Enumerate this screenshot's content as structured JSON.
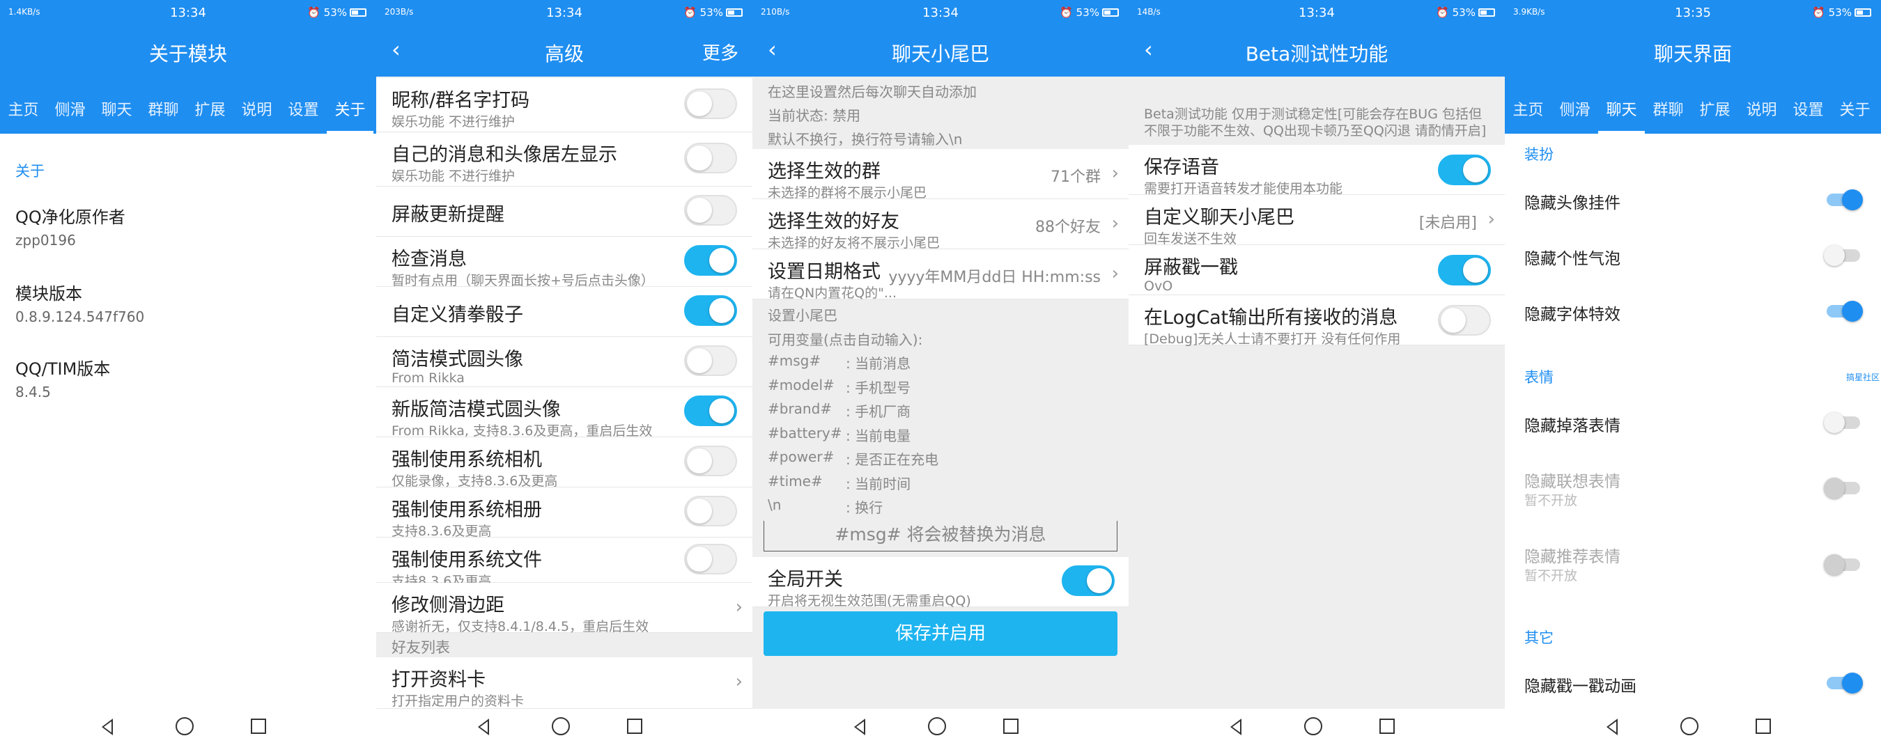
{
  "status": {
    "p1": {
      "net": "1.4KB/s",
      "time": "13:34",
      "battery": "53%"
    },
    "p2": {
      "net": "203B/s",
      "time": "13:34",
      "battery": "53%"
    },
    "p3": {
      "net": "210B/s",
      "time": "13:34",
      "battery": "53%"
    },
    "p4": {
      "net": "14B/s",
      "time": "13:34",
      "battery": "53%"
    },
    "p5": {
      "net": "3.9KB/s",
      "time": "13:35",
      "battery": "53%"
    }
  },
  "tabs": [
    "主页",
    "侧滑",
    "聊天",
    "群聊",
    "扩展",
    "说明",
    "设置",
    "关于"
  ],
  "panel1": {
    "title": "关于模块",
    "section": "关于",
    "items": [
      {
        "title": "QQ净化原作者",
        "sub": "zpp0196"
      },
      {
        "title": "模块版本",
        "sub": "0.8.9.124.547f760"
      },
      {
        "title": "QQ/TIM版本",
        "sub": "8.4.5"
      }
    ]
  },
  "panel2": {
    "title": "高级",
    "more": "更多",
    "rows": [
      {
        "title": "昵称/群名字打码",
        "sub": "娱乐功能 不进行维护",
        "on": false
      },
      {
        "title": "自己的消息和头像居左显示",
        "sub": "娱乐功能 不进行维护",
        "on": false
      },
      {
        "title": "屏蔽更新提醒",
        "sub": "",
        "on": false
      },
      {
        "title": "检查消息",
        "sub": "暂时有点用（聊天界面长按+号后点击头像）",
        "on": true
      },
      {
        "title": "自定义猜拳骰子",
        "sub": "",
        "on": true
      },
      {
        "title": "简洁模式圆头像",
        "sub": "From Rikka",
        "on": false
      },
      {
        "title": "新版简洁模式圆头像",
        "sub": "From Rikka, 支持8.3.6及更高，重启后生效",
        "on": true
      },
      {
        "title": "强制使用系统相机",
        "sub": "仅能录像，支持8.3.6及更高",
        "on": false
      },
      {
        "title": "强制使用系统相册",
        "sub": "支持8.3.6及更高",
        "on": false
      },
      {
        "title": "强制使用系统文件",
        "sub": "支持8.3.6及更高",
        "on": false
      }
    ],
    "side_row": {
      "title": "修改侧滑边距",
      "sub": "感谢祈无，仅支持8.4.1/8.4.5，重启后生效"
    },
    "section": "好友列表",
    "card_row": {
      "title": "打开资料卡",
      "sub": "打开指定用户的资料卡"
    }
  },
  "panel3": {
    "title": "聊天小尾巴",
    "info1": "在这里设置然后每次聊天自动添加",
    "info2": "当前状态: 禁用",
    "info3": "默认不换行，换行符号请输入\\n",
    "rows": [
      {
        "title": "选择生效的群",
        "sub": "未选择的群将不展示小尾巴",
        "value": "71个群"
      },
      {
        "title": "选择生效的好友",
        "sub": "未选择的好友将不展示小尾巴",
        "value": "88个好友"
      },
      {
        "title": "设置日期格式",
        "sub": "请在QN内置花Q的\"...",
        "value": "yyyy年MM月dd日 HH:mm:ss"
      }
    ],
    "vars_title": "设置小尾巴",
    "vars_intro": "可用变量(点击自动输入):",
    "vars": [
      {
        "key": "#msg#",
        "desc": ": 当前消息"
      },
      {
        "key": "#model#",
        "desc": ": 手机型号"
      },
      {
        "key": "#brand#",
        "desc": ": 手机厂商"
      },
      {
        "key": "#battery#",
        "desc": ": 当前电量"
      },
      {
        "key": "#power#",
        "desc": ": 是否正在充电"
      },
      {
        "key": "#time#",
        "desc": ": 当前时间"
      },
      {
        "key": "\\n",
        "desc": ": 换行"
      }
    ],
    "input_placeholder": "#msg# 将会被替换为消息",
    "global": {
      "title": "全局开关",
      "sub": "开启将无视生效范围(无需重启QQ)",
      "on": true
    },
    "save_label": "保存并启用"
  },
  "panel4": {
    "title": "Beta测试性功能",
    "desc": "Beta测试功能 仅用于测试稳定性[可能会存在BUG 包括但不限于功能不生效、QQ出现卡顿乃至QQ闪退 请酌情开启]",
    "rows": [
      {
        "title": "保存语音",
        "sub": "需要打开语音转发才能使用本功能",
        "on": true
      },
      {
        "title": "自定义聊天小尾巴",
        "sub": "回车发送不生效",
        "value": "[未启用]"
      },
      {
        "title": "屏蔽戳一戳",
        "sub": "OvO",
        "on": true
      },
      {
        "title": "在LogCat输出所有接收的消息",
        "sub": "[Debug]无关人士请不要打开 没有任何作用",
        "on": false
      }
    ]
  },
  "panel5": {
    "title": "聊天界面",
    "sec1": "装扮",
    "items1": [
      {
        "title": "隐藏头像挂件",
        "on": true
      },
      {
        "title": "隐藏个性气泡",
        "on": false
      },
      {
        "title": "隐藏字体特效",
        "on": true
      }
    ],
    "sec2": "表情",
    "tiny": "搞星社区",
    "items2": [
      {
        "title": "隐藏掉落表情",
        "sub": "",
        "on": false
      },
      {
        "title": "隐藏联想表情",
        "sub": "暂不开放",
        "on": false
      },
      {
        "title": "隐藏推荐表情",
        "sub": "暂不开放",
        "on": false
      }
    ],
    "sec3": "其它",
    "items3": [
      {
        "title": "隐藏戳一戳动画",
        "on": true
      }
    ]
  },
  "colors": {
    "primary": "#1f8ef1",
    "toggle_on": "#1eb4f0"
  },
  "icons": {
    "alarm": "alarm-icon",
    "back": "back-icon",
    "chevron": "chevron-right-icon",
    "nav_back": "nav-back-icon",
    "nav_home": "nav-home-icon",
    "nav_recent": "nav-recent-icon"
  }
}
